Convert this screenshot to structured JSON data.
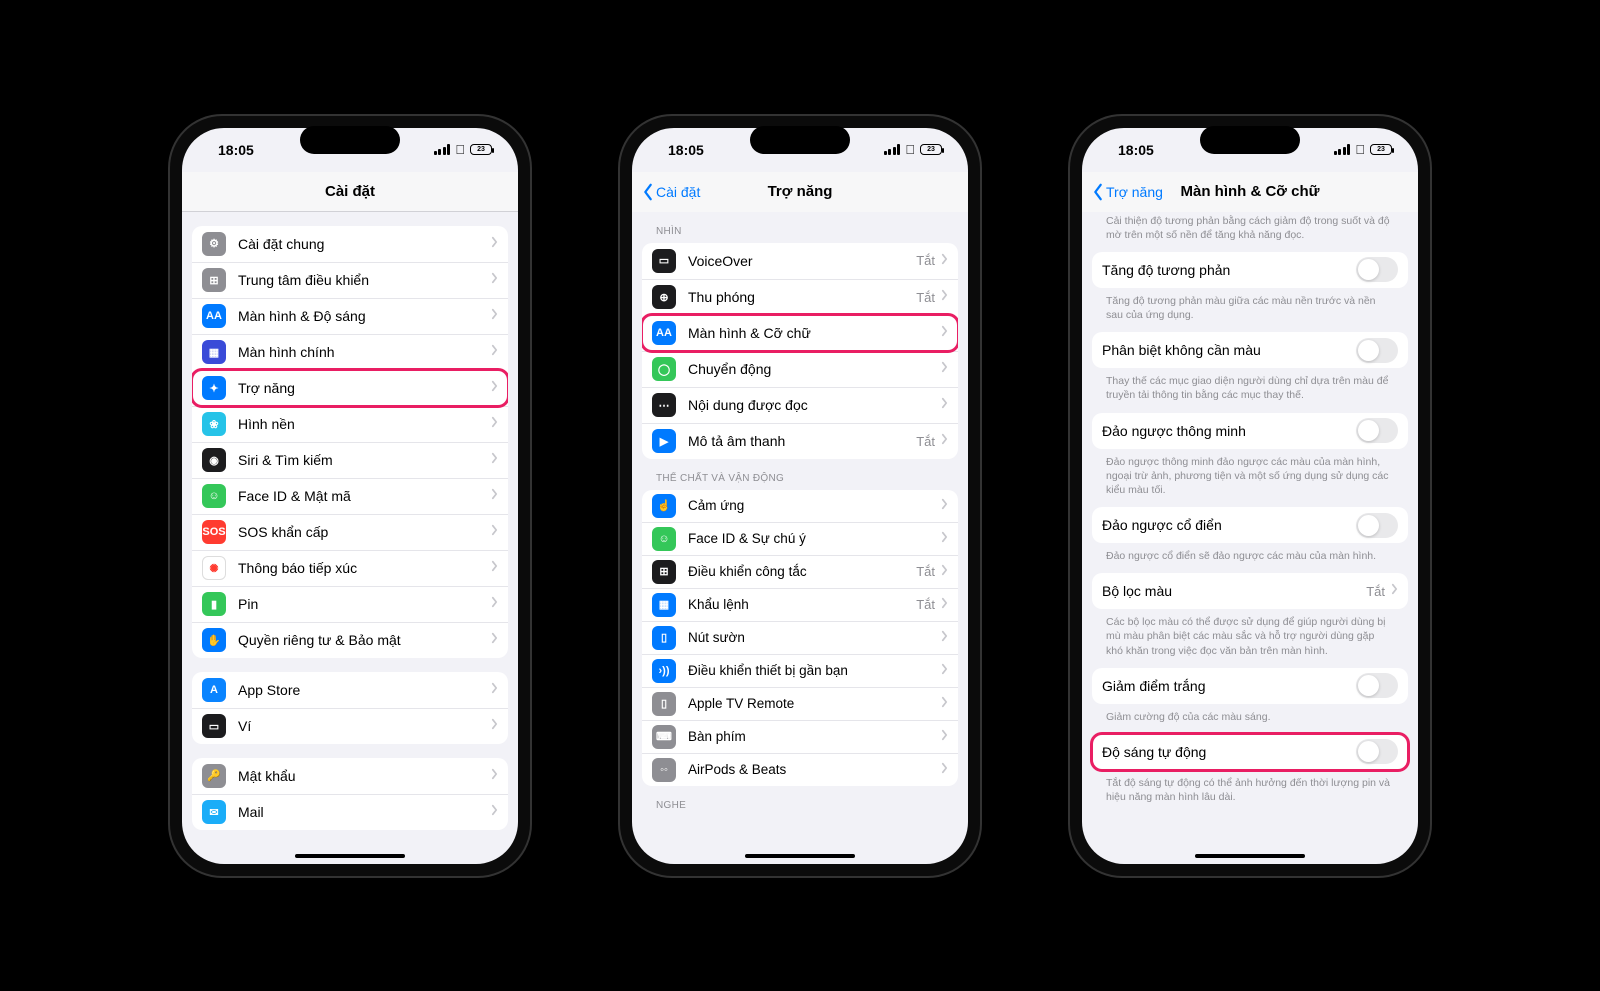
{
  "status": {
    "time": "18:05",
    "battery": "23"
  },
  "p1": {
    "title": "Cài đặt",
    "g1": [
      {
        "label": "Cài đặt chung",
        "icon": "⚙",
        "bg": "#8e8e93"
      },
      {
        "label": "Trung tâm điều khiển",
        "icon": "⊞",
        "bg": "#8e8e93"
      },
      {
        "label": "Màn hình & Độ sáng",
        "icon": "AA",
        "bg": "#007aff"
      },
      {
        "label": "Màn hình chính",
        "icon": "▦",
        "bg": "#3a4bd8"
      },
      {
        "label": "Trợ năng",
        "icon": "✦",
        "bg": "#007aff",
        "hl": true
      },
      {
        "label": "Hình nền",
        "icon": "❀",
        "bg": "#26c3e8"
      },
      {
        "label": "Siri & Tìm kiếm",
        "icon": "◉",
        "bg": "#1c1c1e"
      },
      {
        "label": "Face ID & Mật mã",
        "icon": "☺",
        "bg": "#34c759"
      },
      {
        "label": "SOS khẩn cấp",
        "icon": "SOS",
        "bg": "#ff3b30"
      },
      {
        "label": "Thông báo tiếp xúc",
        "icon": "✺",
        "bg": "#fff",
        "fg": "#ff3b30",
        "bd": "1"
      },
      {
        "label": "Pin",
        "icon": "▮",
        "bg": "#34c759"
      },
      {
        "label": "Quyền riêng tư & Bảo mật",
        "icon": "✋",
        "bg": "#007aff"
      }
    ],
    "g2": [
      {
        "label": "App Store",
        "icon": "A",
        "bg": "#0a84ff"
      },
      {
        "label": "Ví",
        "icon": "▭",
        "bg": "#1c1c1e"
      }
    ],
    "g3": [
      {
        "label": "Mật khẩu",
        "icon": "🔑",
        "bg": "#8e8e93"
      },
      {
        "label": "Mail",
        "icon": "✉",
        "bg": "#1badf8"
      }
    ]
  },
  "p2": {
    "back": "Cài đặt",
    "title": "Trợ năng",
    "h1": "NHÌN",
    "g1": [
      {
        "label": "VoiceOver",
        "val": "Tắt",
        "icon": "▭",
        "bg": "#1c1c1e"
      },
      {
        "label": "Thu phóng",
        "val": "Tắt",
        "icon": "⊕",
        "bg": "#1c1c1e"
      },
      {
        "label": "Màn hình & Cỡ chữ",
        "icon": "AA",
        "bg": "#007aff",
        "hl": true
      },
      {
        "label": "Chuyển động",
        "icon": "◯",
        "bg": "#34c759"
      },
      {
        "label": "Nội dung được đọc",
        "icon": "⋯",
        "bg": "#1c1c1e"
      },
      {
        "label": "Mô tả âm thanh",
        "val": "Tắt",
        "icon": "▶",
        "bg": "#007aff"
      }
    ],
    "h2": "THỂ CHẤT VÀ VẬN ĐỘNG",
    "g2": [
      {
        "label": "Cảm ứng",
        "icon": "☝",
        "bg": "#007aff"
      },
      {
        "label": "Face ID & Sự chú ý",
        "icon": "☺",
        "bg": "#34c759"
      },
      {
        "label": "Điều khiển công tắc",
        "val": "Tắt",
        "icon": "⊞",
        "bg": "#1c1c1e"
      },
      {
        "label": "Khẩu lệnh",
        "val": "Tắt",
        "icon": "▦",
        "bg": "#007aff"
      },
      {
        "label": "Nút sườn",
        "icon": "▯",
        "bg": "#007aff"
      },
      {
        "label": "Điều khiển thiết bị gần bạn",
        "icon": "›))",
        "bg": "#007aff"
      },
      {
        "label": "Apple TV Remote",
        "icon": "▯",
        "bg": "#8e8e93"
      },
      {
        "label": "Bàn phím",
        "icon": "⌨",
        "bg": "#8e8e93"
      },
      {
        "label": "AirPods & Beats",
        "icon": "◦◦",
        "bg": "#8e8e93"
      }
    ],
    "h3": "NGHE"
  },
  "p3": {
    "back": "Trợ năng",
    "title": "Màn hình & Cỡ chữ",
    "intro": "Cải thiện độ tương phản bằng cách giảm độ trong suốt và độ mờ trên một số nền để tăng khả năng đọc.",
    "items": [
      {
        "label": "Tăng độ tương phản",
        "note": "Tăng độ tương phản màu giữa các màu nền trước và nền sau của ứng dụng."
      },
      {
        "label": "Phân biệt không cần màu",
        "note": "Thay thế các mục giao diện người dùng chỉ dựa trên màu để truyền tải thông tin bằng các mục thay thế."
      },
      {
        "label": "Đảo ngược thông minh",
        "note": "Đảo ngược thông minh đảo ngược các màu của màn hình, ngoại trừ ảnh, phương tiện và một số ứng dụng sử dụng các kiểu màu tối."
      },
      {
        "label": "Đảo ngược cổ điển",
        "note": "Đảo ngược cổ điển sẽ đảo ngược các màu của màn hình."
      },
      {
        "label": "Bộ lọc màu",
        "val": "Tắt",
        "note": "Các bộ lọc màu có thể được sử dụng để giúp người dùng bị mù màu phân biệt các màu sắc và hỗ trợ người dùng gặp khó khăn trong việc đọc văn bản trên màn hình."
      },
      {
        "label": "Giảm điểm trắng",
        "note": "Giảm cường độ của các màu sáng."
      },
      {
        "label": "Độ sáng tự động",
        "hl": true,
        "note": "Tắt độ sáng tự động có thể ảnh hưởng đến thời lượng pin và hiệu năng màn hình lâu dài."
      }
    ]
  }
}
